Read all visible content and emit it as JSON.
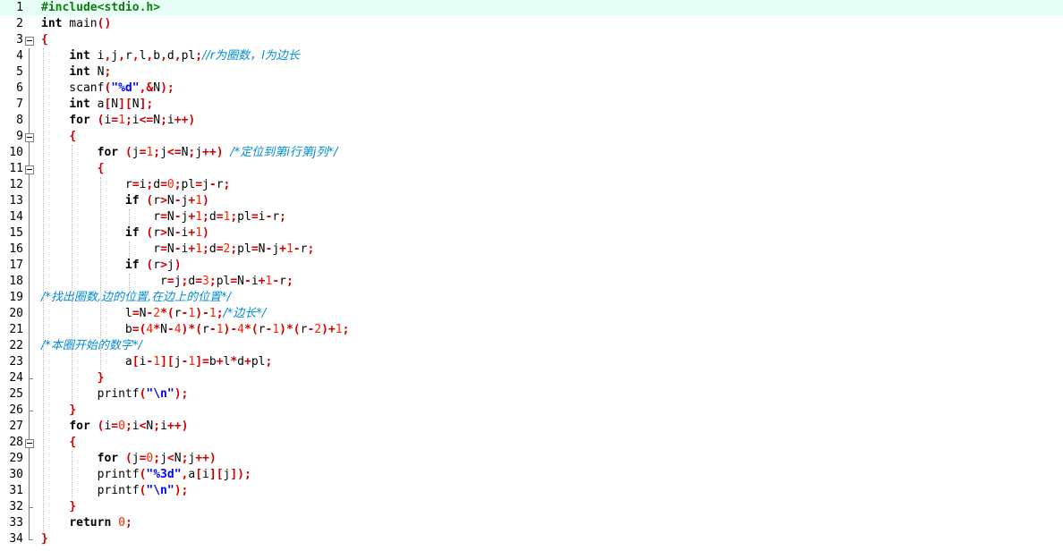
{
  "editor": {
    "current_line": 1,
    "lines": [
      {
        "n": "1",
        "t": "#include<stdio.h>"
      },
      {
        "n": "2",
        "t": "int main()"
      },
      {
        "n": "3",
        "t": "{"
      },
      {
        "n": "4",
        "t": "    int i,j,r,l,b,d,pl;//r为圈数，l为边长"
      },
      {
        "n": "5",
        "t": "    int N;"
      },
      {
        "n": "6",
        "t": "    scanf(\"%d\",&N);"
      },
      {
        "n": "7",
        "t": "    int a[N][N];"
      },
      {
        "n": "8",
        "t": "    for (i=1;i<=N;i++)"
      },
      {
        "n": "9",
        "t": "    {"
      },
      {
        "n": "10",
        "t": "        for (j=1;j<=N;j++) /*定位到第i行第j列*/"
      },
      {
        "n": "11",
        "t": "        {"
      },
      {
        "n": "12",
        "t": "            r=i;d=0;pl=j-r;"
      },
      {
        "n": "13",
        "t": "            if (r>N-j+1)"
      },
      {
        "n": "14",
        "t": "                r=N-j+1;d=1;pl=i-r;"
      },
      {
        "n": "15",
        "t": "            if (r>N-i+1)"
      },
      {
        "n": "16",
        "t": "                r=N-i+1;d=2;pl=N-j+1-r;"
      },
      {
        "n": "17",
        "t": "            if (r>j)"
      },
      {
        "n": "18",
        "t": "                 r=j;d=3;pl=N-i+1-r;"
      },
      {
        "n": "19",
        "t": "/*找出圈数,边的位置,在边上的位置*/"
      },
      {
        "n": "20",
        "t": "            l=N-2*(r-1)-1;/*边长*/"
      },
      {
        "n": "21",
        "t": "            b=(4*N-4)*(r-1)-4*(r-1)*(r-2)+1;"
      },
      {
        "n": "22",
        "t": "/*本圈开始的数字*/"
      },
      {
        "n": "23",
        "t": "            a[i-1][j-1]=b+l*d+pl;"
      },
      {
        "n": "24",
        "t": "        }"
      },
      {
        "n": "25",
        "t": "        printf(\"\\n\");"
      },
      {
        "n": "26",
        "t": "    }"
      },
      {
        "n": "27",
        "t": "    for (i=0;i<N;i++)"
      },
      {
        "n": "28",
        "t": "    {"
      },
      {
        "n": "29",
        "t": "        for (j=0;j<N;j++)"
      },
      {
        "n": "30",
        "t": "        printf(\"%3d\",a[i][j]);"
      },
      {
        "n": "31",
        "t": "        printf(\"\\n\");"
      },
      {
        "n": "32",
        "t": "    }"
      },
      {
        "n": "33",
        "t": "    return 0;"
      },
      {
        "n": "34",
        "t": "}"
      }
    ]
  }
}
